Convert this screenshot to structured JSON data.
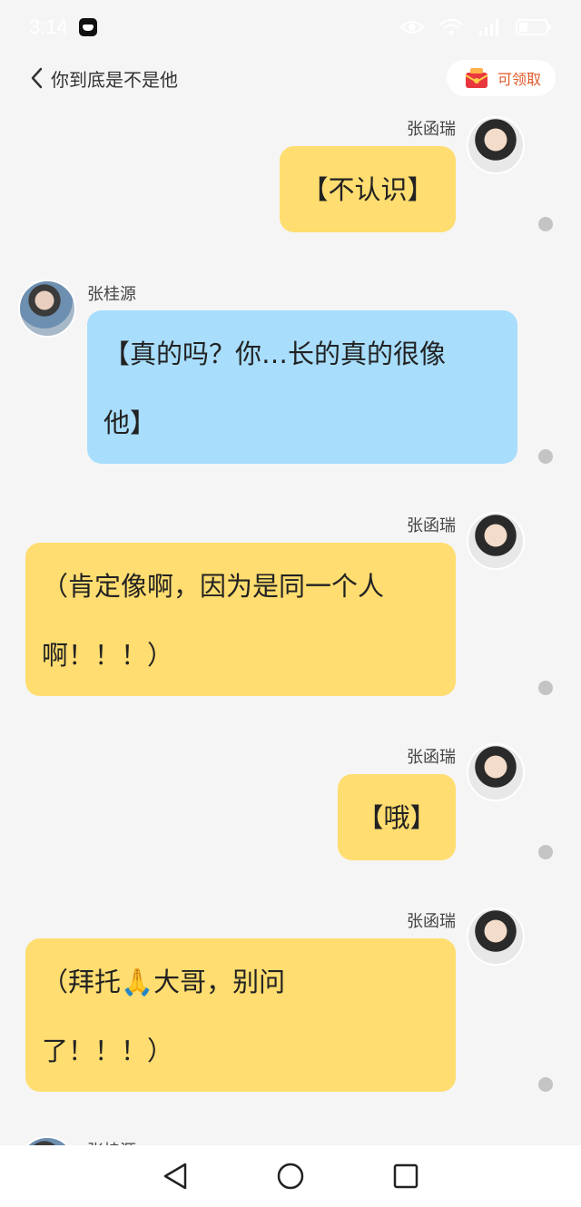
{
  "status_bar": {
    "time": "3:14"
  },
  "header": {
    "back_icon": "chevron-left-icon",
    "title": "你到底是不是他",
    "reward_label": "可领取",
    "reward_icon": "red-envelope-icon"
  },
  "colors": {
    "me_bubble": "#ffdd70",
    "other_bubble": "#a8ddfc",
    "background": "#f5f5f5"
  },
  "messages": [
    {
      "sender": "张函瑞",
      "side": "right",
      "lines": [
        "【不认识】"
      ]
    },
    {
      "sender": "张桂源",
      "side": "left",
      "lines": [
        "【真的吗？你…长的真的很像",
        "他】"
      ]
    },
    {
      "sender": "张函瑞",
      "side": "right",
      "lines": [
        "（肯定像啊，因为是同一个人",
        "啊！！！）"
      ]
    },
    {
      "sender": "张函瑞",
      "side": "right",
      "lines": [
        "【哦】"
      ]
    },
    {
      "sender": "张函瑞",
      "side": "right",
      "lines": [
        "（拜托🙏大哥，别问",
        "了！！！）"
      ]
    },
    {
      "sender": "张桂源",
      "side": "left",
      "lines": []
    }
  ],
  "nav": {
    "back": "triangle-back-icon",
    "home": "circle-home-icon",
    "recents": "square-recents-icon"
  }
}
